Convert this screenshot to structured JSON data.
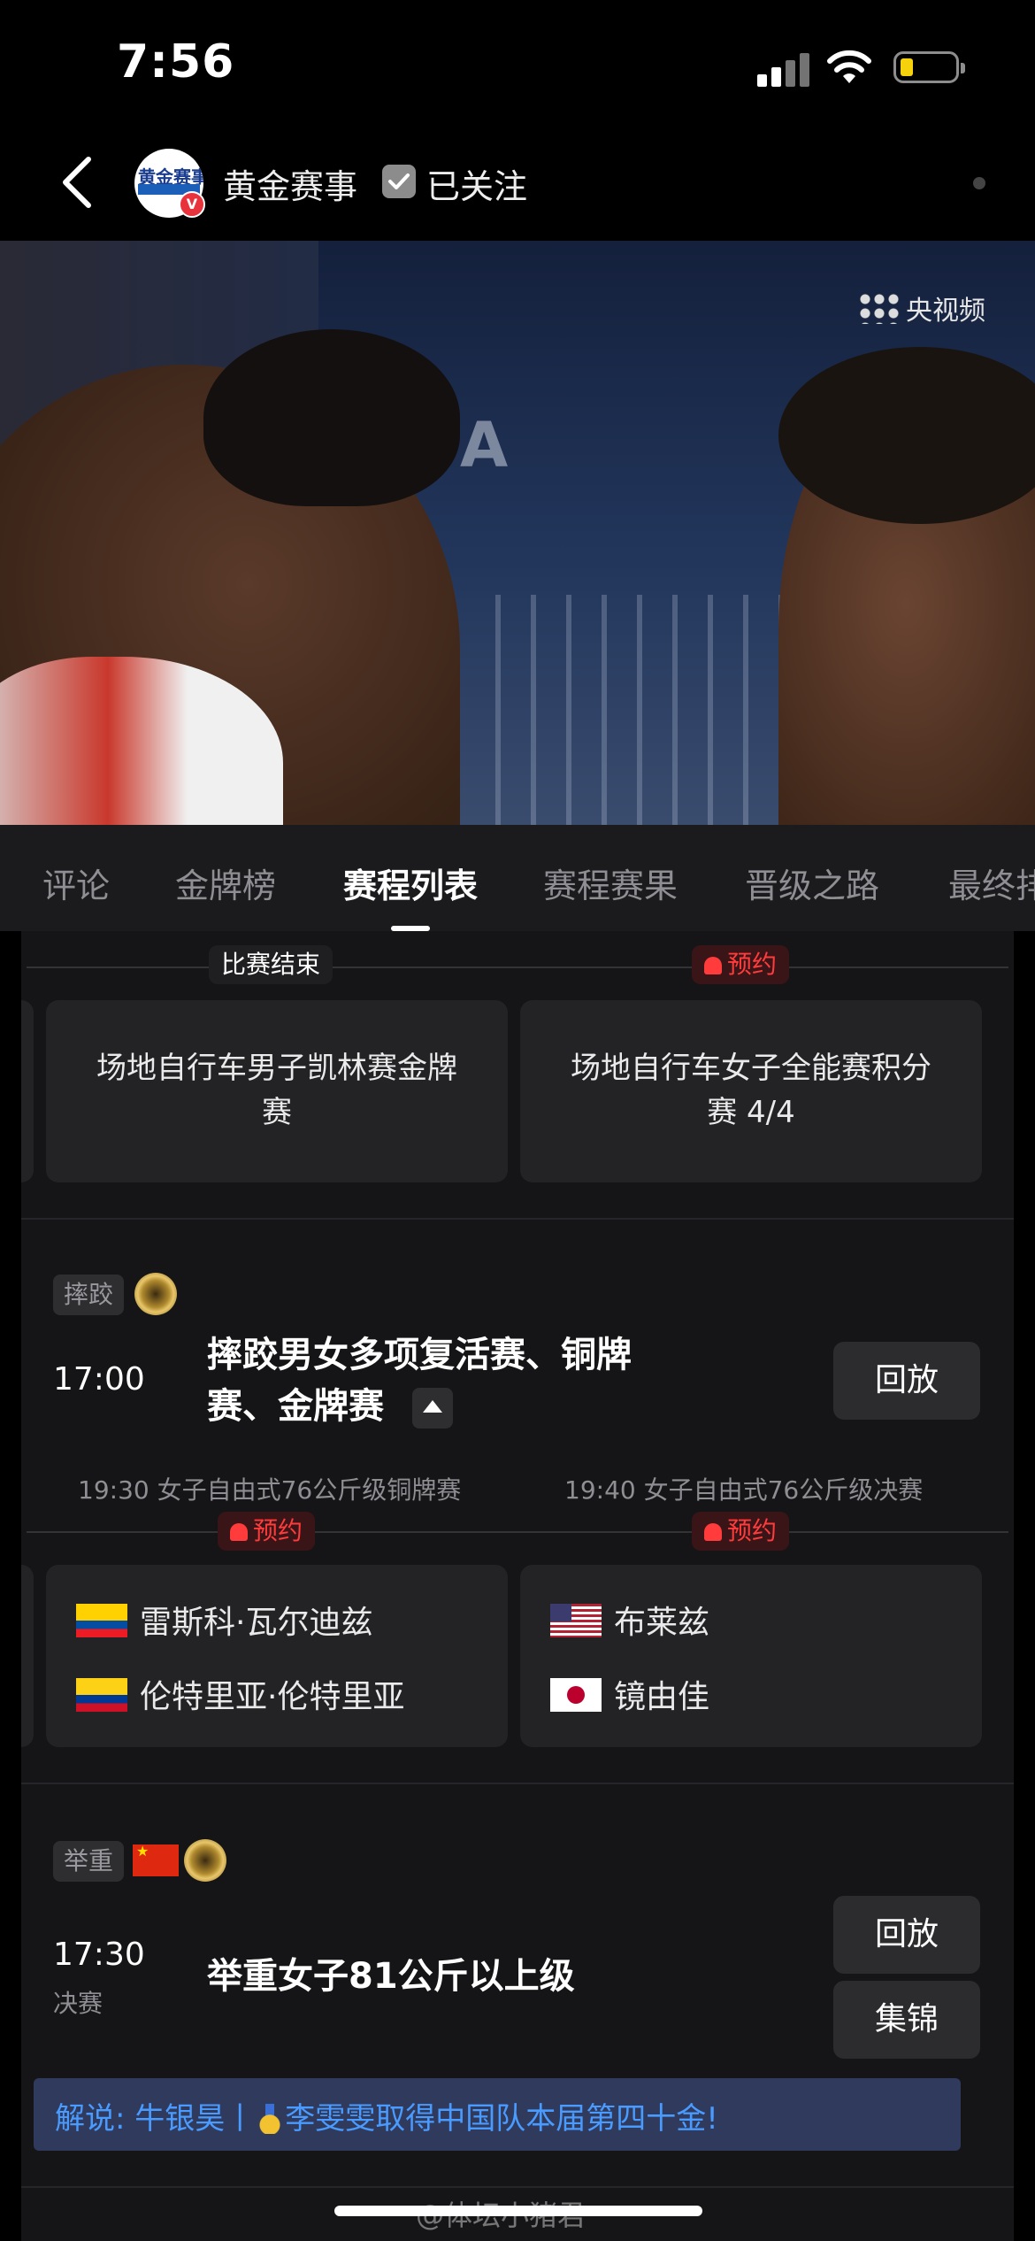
{
  "status_bar": {
    "time": "7:56"
  },
  "header": {
    "channel_name": "黄金赛事",
    "avatar_text": "黄金赛事",
    "verified_badge": "V",
    "follow_label": "已关注"
  },
  "video": {
    "watermark": "央视频"
  },
  "tabs": [
    {
      "label": "评论"
    },
    {
      "label": "金牌榜"
    },
    {
      "label": "赛程列表",
      "active": true
    },
    {
      "label": "赛程赛果"
    },
    {
      "label": "晋级之路"
    },
    {
      "label": "最终排"
    }
  ],
  "cycling": {
    "left": {
      "status": "比赛结束",
      "title_line1": "场地自行车男子凯林赛金牌",
      "title_line2": "赛"
    },
    "right": {
      "status": "预约",
      "title_line1": "场地自行车女子全能赛积分",
      "title_line2": "赛 4/4"
    }
  },
  "wrestling": {
    "sport_tag": "摔跤",
    "time": "17:00",
    "title_line1": "摔跤男女多项复活赛、铜牌",
    "title_line2": "赛、金牌赛",
    "button": "回放",
    "sub_events": [
      {
        "label": "19:30 女子自由式76公斤级铜牌赛",
        "status": "预约",
        "athletes": [
          {
            "name": "雷斯科·瓦尔迪兹",
            "flag": "Ecuador"
          },
          {
            "name": "伦特里亚·伦特里亚",
            "flag": "Colombia"
          }
        ]
      },
      {
        "label": "19:40 女子自由式76公斤级决赛",
        "status": "预约",
        "athletes": [
          {
            "name": "布莱兹",
            "flag": "USA"
          },
          {
            "name": "镜由佳",
            "flag": "Japan"
          }
        ]
      }
    ]
  },
  "weightlifting": {
    "sport_tag": "举重",
    "time": "17:30",
    "stage": "决赛",
    "title": "举重女子81公斤以上级",
    "buttons": {
      "replay": "回放",
      "highlights": "集锦"
    },
    "commentary_prefix": "解说: 牛银昊丨",
    "commentary_text": "李雯雯取得中国队本届第四十金!"
  },
  "footer": {
    "watermark": "@体坛小猪君"
  },
  "colors": {
    "accent_red": "#ff3b3b",
    "commentary_blue": "#4a9bff",
    "card_bg": "#232326"
  }
}
